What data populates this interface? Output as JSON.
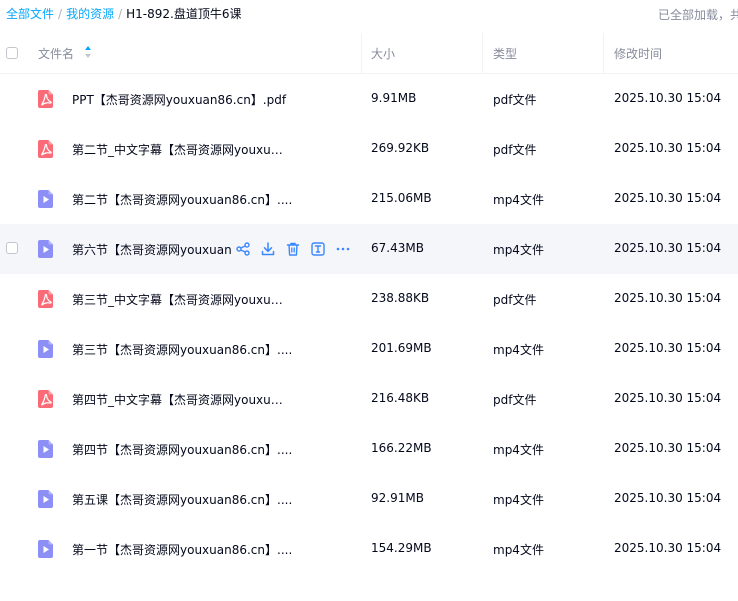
{
  "breadcrumb": {
    "items": [
      "全部文件",
      "我的资源"
    ],
    "separator": "/",
    "current": "H1-892.盘道顶牛6课"
  },
  "status": {
    "loaded_text": "已全部加载，共"
  },
  "columns": {
    "name": "文件名",
    "size": "大小",
    "type": "类型",
    "modified": "修改时间"
  },
  "colors": {
    "accent": "#06a7ff",
    "pdf_icon": "#fb6b77",
    "video_icon": "#8c8ff6",
    "action_icon": "#3a88fe"
  },
  "files": [
    {
      "name": "PPT【杰哥资源网youxuan86.cn】.pdf",
      "size": "9.91MB",
      "type": "pdf文件",
      "modified": "2025.10.30 15:04",
      "icon": "pdf-icon"
    },
    {
      "name": "第二节_中文字幕【杰哥资源网youxu…",
      "size": "269.92KB",
      "type": "pdf文件",
      "modified": "2025.10.30 15:04",
      "icon": "pdf-icon"
    },
    {
      "name": "第二节【杰哥资源网youxuan86.cn】....",
      "size": "215.06MB",
      "type": "mp4文件",
      "modified": "2025.10.30 15:04",
      "icon": "video-icon"
    },
    {
      "name": "第六节【杰哥资源网youxuan8",
      "size": "67.43MB",
      "type": "mp4文件",
      "modified": "2025.10.30 15:04",
      "icon": "video-icon"
    },
    {
      "name": "第三节_中文字幕【杰哥资源网youxu…",
      "size": "238.88KB",
      "type": "pdf文件",
      "modified": "2025.10.30 15:04",
      "icon": "pdf-icon"
    },
    {
      "name": "第三节【杰哥资源网youxuan86.cn】....",
      "size": "201.69MB",
      "type": "mp4文件",
      "modified": "2025.10.30 15:04",
      "icon": "video-icon"
    },
    {
      "name": "第四节_中文字幕【杰哥资源网youxu…",
      "size": "216.48KB",
      "type": "pdf文件",
      "modified": "2025.10.30 15:04",
      "icon": "pdf-icon"
    },
    {
      "name": "第四节【杰哥资源网youxuan86.cn】....",
      "size": "166.22MB",
      "type": "mp4文件",
      "modified": "2025.10.30 15:04",
      "icon": "video-icon"
    },
    {
      "name": "第五课【杰哥资源网youxuan86.cn】....",
      "size": "92.91MB",
      "type": "mp4文件",
      "modified": "2025.10.30 15:04",
      "icon": "video-icon"
    },
    {
      "name": "第一节【杰哥资源网youxuan86.cn】....",
      "size": "154.29MB",
      "type": "mp4文件",
      "modified": "2025.10.30 15:04",
      "icon": "video-icon"
    }
  ],
  "row_actions": [
    "share-icon",
    "download-icon",
    "delete-icon",
    "rename-icon",
    "more-icon"
  ]
}
